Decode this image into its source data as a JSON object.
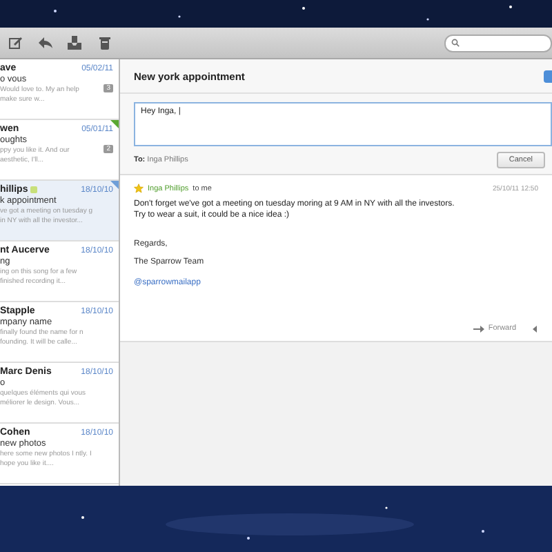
{
  "toolbar": {
    "buttons": [
      {
        "kind": "compose"
      },
      {
        "kind": "reply"
      },
      {
        "kind": "archive"
      },
      {
        "kind": "trash"
      }
    ]
  },
  "messages": [
    {
      "sender": "ave",
      "date": "05/02/11",
      "subject": "o vous",
      "preview": "Would love to. My an help make sure w...",
      "count": "3",
      "tagged": false,
      "selected": false
    },
    {
      "sender": "wen",
      "date": "05/01/11",
      "subject": "oughts",
      "preview": "ppy you like it. And our aesthetic, I'll...",
      "count": "2",
      "color": "#5aa832",
      "tagged": false,
      "selected": false
    },
    {
      "sender": "hillips",
      "date": "18/10/10",
      "subject": "k appointment",
      "preview": "ve got a meeting on tuesday g in NY with all the investor...",
      "color": "#6f9fd8",
      "tagged": true,
      "selected": true
    },
    {
      "sender": "nt Aucerve",
      "date": "18/10/10",
      "subject": "ng",
      "preview": "ing on this song for a few finished recording it...",
      "tagged": false,
      "selected": false
    },
    {
      "sender": "Stapple",
      "date": "18/10/10",
      "subject": "mpany name",
      "preview": "finally found the name for n founding. It will be calle...",
      "tagged": false,
      "selected": false
    },
    {
      "sender": "Marc Denis",
      "date": "18/10/10",
      "subject": "o",
      "preview": "quelques éléments qui vous méliorer le design. Vous...",
      "tagged": false,
      "selected": false
    },
    {
      "sender": "Cohen",
      "date": "18/10/10",
      "subject": "new photos",
      "preview": "here some new photos I ntly. I hope you like it....",
      "tagged": false,
      "selected": false
    }
  ],
  "conversation": {
    "title": "New york appointment",
    "reply": {
      "value": "Hey Inga, |",
      "to_label": "To:",
      "to": "Inga Phillips",
      "cancel": "Cancel"
    },
    "message": {
      "starred": true,
      "from": "Inga Phillips",
      "to": "to me",
      "date": "25/10/11 12:50",
      "body": [
        "Don't forget we've got a meeting on tuesday moring at 9 AM in NY with all the investors.",
        "Try to wear a suit, it could be a nice idea :)"
      ],
      "closing": "Regards,",
      "signature": "The Sparrow Team",
      "link": "@sparrowmailapp",
      "forward": "Forward"
    }
  }
}
